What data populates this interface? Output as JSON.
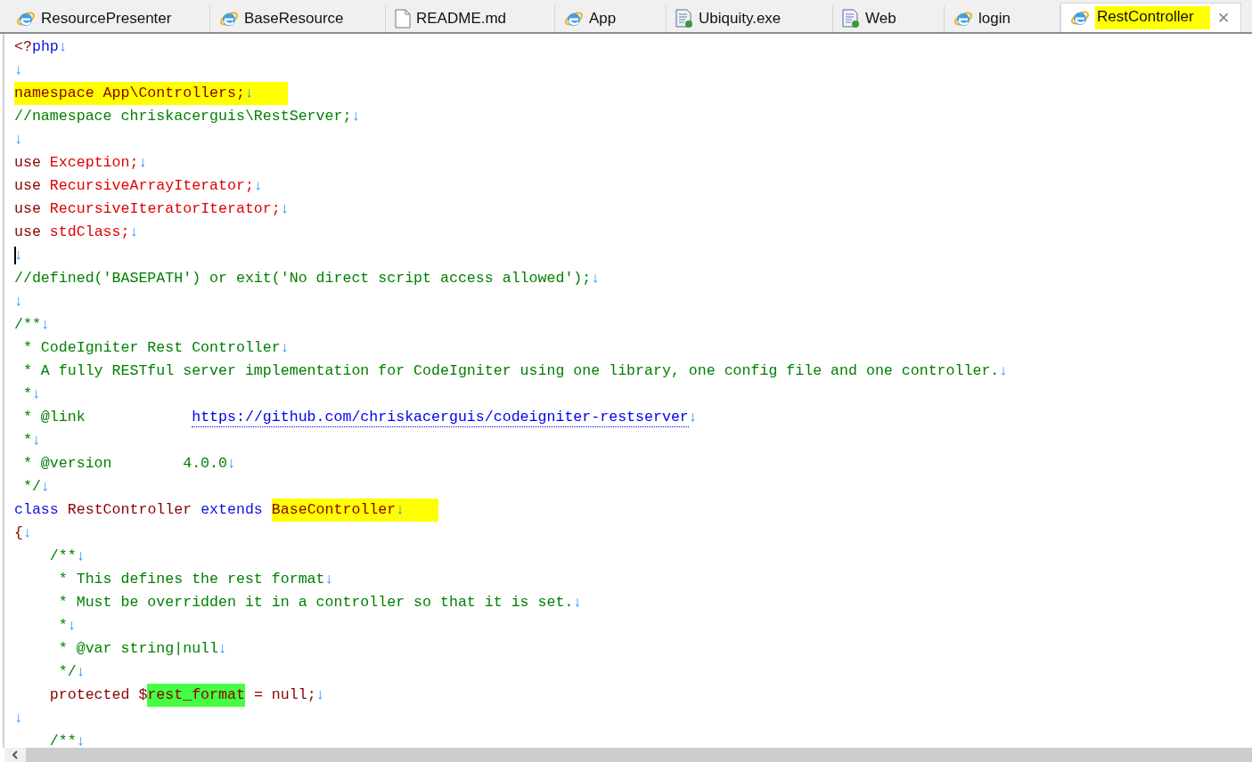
{
  "tabs": [
    {
      "label": "ResourcePresenter",
      "kind": "browser",
      "selected": false,
      "highlighted": false
    },
    {
      "label": "BaseResource",
      "kind": "browser",
      "selected": false,
      "highlighted": false
    },
    {
      "label": "README.md",
      "kind": "file",
      "selected": false,
      "highlighted": false
    },
    {
      "label": "App",
      "kind": "browser",
      "selected": false,
      "highlighted": false
    },
    {
      "label": "Ubiquity.exe",
      "kind": "document",
      "selected": false,
      "highlighted": false
    },
    {
      "label": "Web",
      "kind": "document",
      "selected": false,
      "highlighted": false
    },
    {
      "label": "login",
      "kind": "browser",
      "selected": false,
      "highlighted": false
    },
    {
      "label": "RestController",
      "kind": "browser",
      "selected": true,
      "highlighted": true,
      "close": "✕"
    }
  ],
  "editor": {
    "lines": [
      [
        {
          "t": "<?",
          "kind": "tag"
        },
        {
          "t": "php",
          "kind": "keyword"
        },
        {
          "t": "↓",
          "kind": "eol"
        }
      ],
      [
        {
          "t": "↓",
          "kind": "eol"
        }
      ],
      [
        {
          "t": "namespace App\\Controllers;",
          "kind": "code",
          "color": "#ffff00"
        },
        {
          "t": "↓",
          "kind": "eol",
          "color": "#ffff00"
        }
      ],
      [
        {
          "t": "//namespace chriskacerguis\\RestServer;",
          "kind": "comment"
        },
        {
          "t": "↓",
          "kind": "eol"
        }
      ],
      [
        {
          "t": "↓",
          "kind": "eol"
        }
      ],
      [
        {
          "t": "use ",
          "kind": "code"
        },
        {
          "t": "Exception;",
          "kind": "class"
        },
        {
          "t": "↓",
          "kind": "eol"
        }
      ],
      [
        {
          "t": "use ",
          "kind": "code"
        },
        {
          "t": "RecursiveArrayIterator;",
          "kind": "class"
        },
        {
          "t": "↓",
          "kind": "eol"
        }
      ],
      [
        {
          "t": "use ",
          "kind": "code"
        },
        {
          "t": "RecursiveIteratorIterator;",
          "kind": "class"
        },
        {
          "t": "↓",
          "kind": "eol"
        }
      ],
      [
        {
          "t": "use ",
          "kind": "code"
        },
        {
          "t": "stdClass;",
          "kind": "class"
        },
        {
          "t": "↓",
          "kind": "eol"
        }
      ],
      [
        {
          "kind": "caret"
        },
        {
          "t": "↓",
          "kind": "eol"
        }
      ],
      [
        {
          "t": "//defined('BASEPATH') or exit('No direct script access allowed');",
          "kind": "comment"
        },
        {
          "t": "↓",
          "kind": "eol"
        }
      ],
      [
        {
          "t": "↓",
          "kind": "eol"
        }
      ],
      [
        {
          "t": "/**",
          "kind": "comment"
        },
        {
          "t": "↓",
          "kind": "eol"
        }
      ],
      [
        {
          "t": " * CodeIgniter Rest Controller",
          "kind": "comment"
        },
        {
          "t": "↓",
          "kind": "eol"
        }
      ],
      [
        {
          "t": " * A fully RESTful server implementation for CodeIgniter using one library, one config file and one controller.",
          "kind": "comment"
        },
        {
          "t": "↓",
          "kind": "eol"
        }
      ],
      [
        {
          "t": " *",
          "kind": "comment"
        },
        {
          "t": "↓",
          "kind": "eol"
        }
      ],
      [
        {
          "t": " * @link            ",
          "kind": "comment"
        },
        {
          "t": "https://github.com/chriskacerguis/codeigniter-restserver",
          "kind": "link"
        },
        {
          "t": "↓",
          "kind": "eol"
        }
      ],
      [
        {
          "t": " *",
          "kind": "comment"
        },
        {
          "t": "↓",
          "kind": "eol"
        }
      ],
      [
        {
          "t": " * @version        4.0.0",
          "kind": "comment"
        },
        {
          "t": "↓",
          "kind": "eol"
        }
      ],
      [
        {
          "t": " */",
          "kind": "comment"
        },
        {
          "t": "↓",
          "kind": "eol"
        }
      ],
      [
        {
          "t": "class",
          "kind": "keyword"
        },
        {
          "t": " RestController ",
          "kind": "code"
        },
        {
          "t": "extends ",
          "kind": "keyword"
        },
        {
          "t": "BaseController",
          "kind": "code",
          "color": "#ffff00"
        },
        {
          "t": "↓",
          "kind": "eol",
          "color": "#ffff00"
        }
      ],
      [
        {
          "t": "{",
          "kind": "code"
        },
        {
          "t": "↓",
          "kind": "eol"
        }
      ],
      [
        {
          "t": "    /**",
          "kind": "comment"
        },
        {
          "t": "↓",
          "kind": "eol"
        }
      ],
      [
        {
          "t": "     * This defines the rest format",
          "kind": "comment"
        },
        {
          "t": "↓",
          "kind": "eol"
        }
      ],
      [
        {
          "t": "     * Must be overridden it in a controller so that it is set.",
          "kind": "comment"
        },
        {
          "t": "↓",
          "kind": "eol"
        }
      ],
      [
        {
          "t": "     *",
          "kind": "comment"
        },
        {
          "t": "↓",
          "kind": "eol"
        }
      ],
      [
        {
          "t": "     * @var string|null",
          "kind": "comment"
        },
        {
          "t": "↓",
          "kind": "eol"
        }
      ],
      [
        {
          "t": "     */",
          "kind": "comment"
        },
        {
          "t": "↓",
          "kind": "eol"
        }
      ],
      [
        {
          "t": "    protected $",
          "kind": "code"
        },
        {
          "t": "rest_format",
          "kind": "code",
          "color": "#44ff44"
        },
        {
          "t": " = null;",
          "kind": "code"
        },
        {
          "t": "↓",
          "kind": "eol"
        }
      ],
      [
        {
          "t": "↓",
          "kind": "eol"
        }
      ],
      [
        {
          "t": "    /**",
          "kind": "comment"
        },
        {
          "t": "↓",
          "kind": "eol"
        }
      ]
    ]
  }
}
